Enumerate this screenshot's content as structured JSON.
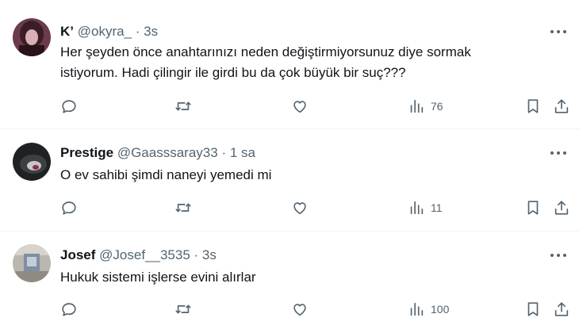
{
  "tweets": [
    {
      "name": "K’",
      "handle": "@okyra_",
      "separator": "·",
      "time": "3s",
      "text_line1": "Her şeyden önce anahtarınızı neden değiştirmiyorsunuz diye sormak",
      "text_line2": "istiyorum. Hadi çilingir ile girdi bu da çok büyük bir suç???",
      "views": "76"
    },
    {
      "name": "Prestige",
      "handle": "@Gaasssaray33",
      "separator": "·",
      "time": "1 sa",
      "text_line1": "O ev sahibi şimdi naneyi yemedi mi",
      "views": "11"
    },
    {
      "name": "Josef",
      "handle": "@Josef__3535",
      "separator": "·",
      "time": "3s",
      "text_line1": "Hukuk sistemi işlerse evini alırlar",
      "views": "100"
    }
  ],
  "icons": [
    "more-icon",
    "reply-icon",
    "retweet-icon",
    "like-icon",
    "views-icon",
    "bookmark-icon",
    "share-icon"
  ],
  "colors": {
    "text": "#0f1419",
    "secondary": "#536471",
    "divider": "#eff3f4"
  }
}
